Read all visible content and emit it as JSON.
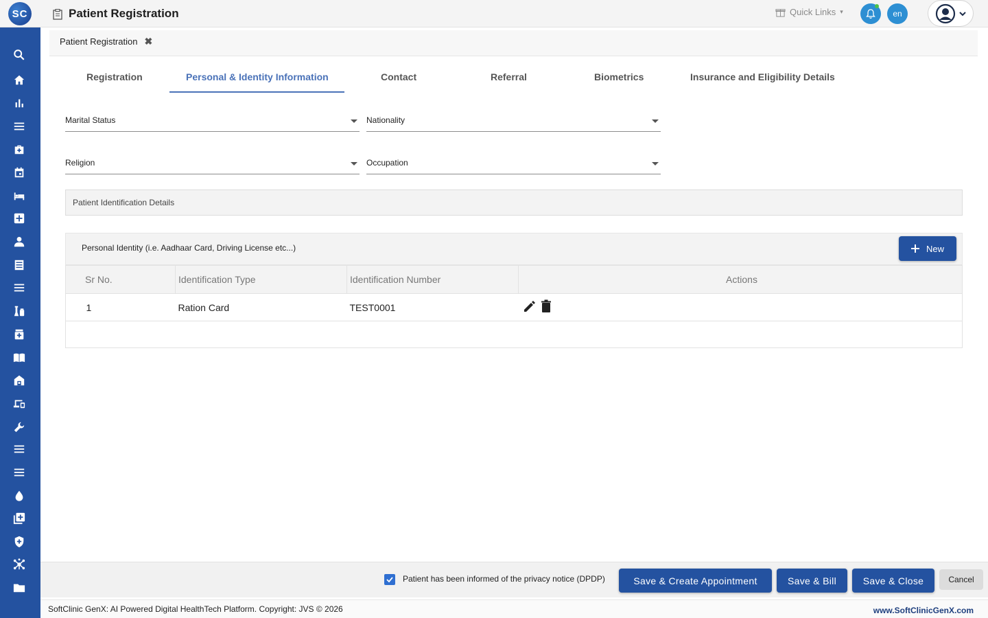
{
  "app": {
    "logo_text": "SC",
    "page_title": "Patient Registration",
    "quick_links": "Quick Links",
    "language": "en"
  },
  "breadcrumb": {
    "label": "Patient Registration",
    "close": "✖"
  },
  "tabs": [
    {
      "label": "Registration",
      "active": false
    },
    {
      "label": "Personal & Identity Information",
      "active": true
    },
    {
      "label": "Contact",
      "active": false
    },
    {
      "label": "Referral",
      "active": false
    },
    {
      "label": "Biometrics",
      "active": false
    },
    {
      "label": "Insurance and Eligibility Details",
      "active": false
    }
  ],
  "fields": {
    "marital_status": "Marital Status",
    "nationality": "Nationality",
    "religion": "Religion",
    "occupation": "Occupation"
  },
  "section_title": "Patient Identification Details",
  "identity_grid": {
    "title": "Personal Identity (i.e. Aadhaar Card, Driving License etc...)",
    "new_button": "New",
    "columns": [
      "Sr No.",
      "Identification Type",
      "Identification Number",
      "Actions"
    ],
    "rows": [
      {
        "sr": "1",
        "type": "Ration Card",
        "number": "TEST0001"
      }
    ]
  },
  "footer": {
    "privacy_checked": true,
    "privacy_label": "Patient has been informed of the privacy notice (DPDP)",
    "save_create_appointment": "Save & Create Appointment",
    "save_bill": "Save & Bill",
    "save_close": "Save & Close",
    "cancel": "Cancel",
    "copyright": "SoftClinic GenX: AI Powered Digital HealthTech Platform. Copyright: JVS © 2026",
    "website": "www.SoftClinicGenX.com"
  },
  "sidebar_icons": [
    "search-icon",
    "home-icon",
    "bar-chart-icon",
    "menu-icon",
    "medical-bag-icon",
    "calendar-icon",
    "bed-icon",
    "hospital-plus-icon",
    "person-icon",
    "document-icon",
    "list-icon",
    "lab-icon",
    "pharmacy-icon",
    "book-icon",
    "building-icon",
    "devices-icon",
    "wrench-icon",
    "lines-icon",
    "lines-icon-2",
    "drop-icon",
    "add-box-icon",
    "shield-icon",
    "network-icon",
    "folder-icon"
  ],
  "colors": {
    "primary": "#2452a0",
    "active_tab": "#4a72b8",
    "notify": "#2d8fd3"
  }
}
